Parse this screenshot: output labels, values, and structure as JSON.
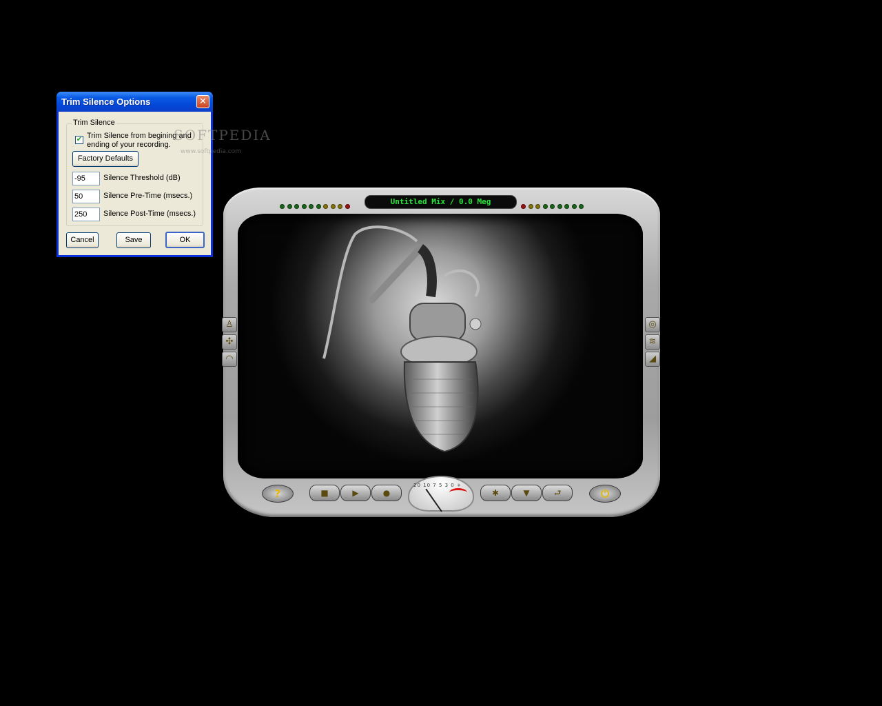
{
  "dialog": {
    "title": "Trim Silence Options",
    "close_glyph": "✕",
    "group_label": "Trim Silence",
    "checkbox_checked": true,
    "checkbox_label": "Trim Silence from begining and ending of your recording.",
    "factory_defaults_label": "Factory Defaults",
    "fields": [
      {
        "value": "-95",
        "label": "Silence Threshold (dB)"
      },
      {
        "value": "50",
        "label": "Silence Pre-Time (msecs.)"
      },
      {
        "value": "250",
        "label": "Silence Post-Time (msecs.)"
      }
    ],
    "cancel_label": "Cancel",
    "save_label": "Save",
    "ok_label": "OK"
  },
  "watermark": {
    "text": "SOFTPEDIA",
    "sub": "www.softpedia.com"
  },
  "player": {
    "title": "Untitled Mix / 0.0 Meg",
    "meter_scale": "20 10 7 5 3 0 +",
    "meter_level_fraction": 0.15,
    "left_leds": [
      "#1d6b1d",
      "#1d6b1d",
      "#1d6b1d",
      "#1d6b1d",
      "#1d6b1d",
      "#1d6b1d",
      "#8a7a10",
      "#8a7a10",
      "#8a7a10",
      "#a01515"
    ],
    "right_leds": [
      "#a01515",
      "#8a7a10",
      "#8a7a10",
      "#1d6b1d",
      "#1d6b1d",
      "#1d6b1d",
      "#1d6b1d",
      "#1d6b1d",
      "#1d6b1d"
    ],
    "side_left_icons": [
      "metronome-icon",
      "effects-icon",
      "fade-icon"
    ],
    "side_right_icons": [
      "cd-icon",
      "waveform-icon",
      "ramp-icon"
    ],
    "help_glyph": "?",
    "power_glyph": "⏻",
    "stop_glyph": "■",
    "play_glyph": "▶",
    "record_glyph": "●",
    "effects_glyph": "✱",
    "down_glyph": "▼",
    "back_glyph": "⮐"
  }
}
